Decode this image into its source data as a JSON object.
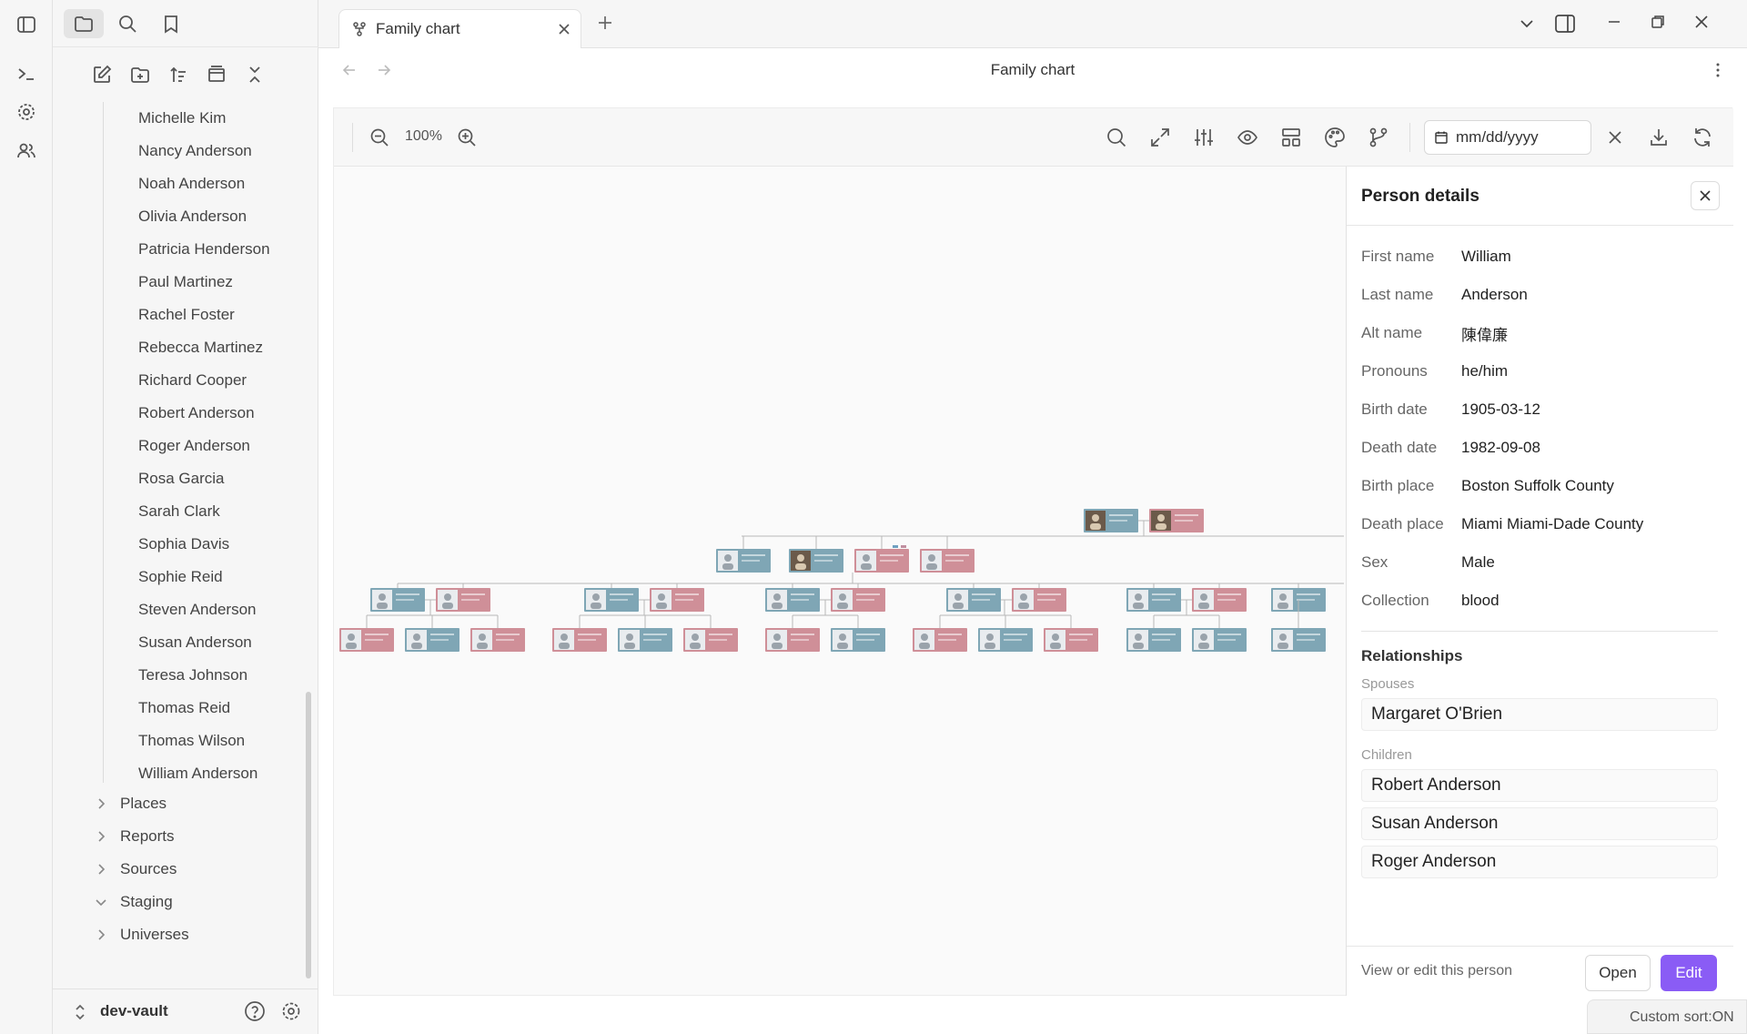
{
  "app": {
    "tab_title": "Family chart",
    "view_title": "Family chart",
    "vault_name": "dev-vault",
    "status": "Custom sort:ON"
  },
  "sidebar": {
    "people": [
      "Michelle Kim",
      "Nancy Anderson",
      "Noah Anderson",
      "Olivia Anderson",
      "Patricia Henderson",
      "Paul Martinez",
      "Rachel Foster",
      "Rebecca Martinez",
      "Richard Cooper",
      "Robert Anderson",
      "Roger Anderson",
      "Rosa Garcia",
      "Sarah Clark",
      "Sophia Davis",
      "Sophie Reid",
      "Steven Anderson",
      "Susan Anderson",
      "Teresa Johnson",
      "Thomas Reid",
      "Thomas Wilson",
      "William Anderson"
    ],
    "folders": [
      {
        "label": "Places",
        "expanded": false
      },
      {
        "label": "Reports",
        "expanded": false
      },
      {
        "label": "Sources",
        "expanded": false
      },
      {
        "label": "Staging",
        "expanded": true
      },
      {
        "label": "Universes",
        "expanded": false
      }
    ]
  },
  "toolbar": {
    "zoom": "100%",
    "date_placeholder": "mm/dd/yyyy"
  },
  "colors": {
    "male": "#7fa6b5",
    "female": "#cf8f98",
    "accent": "#8a5cf5"
  },
  "details": {
    "title": "Person details",
    "fields": [
      {
        "label": "First name",
        "value": "William"
      },
      {
        "label": "Last name",
        "value": "Anderson"
      },
      {
        "label": "Alt name",
        "value": "陳偉廉"
      },
      {
        "label": "Pronouns",
        "value": "he/him"
      },
      {
        "label": "Birth date",
        "value": "1905-03-12"
      },
      {
        "label": "Death date",
        "value": "1982-09-08"
      },
      {
        "label": "Birth place",
        "value": "Boston Suffolk County"
      },
      {
        "label": "Death place",
        "value": "Miami Miami-Dade County"
      },
      {
        "label": "Sex",
        "value": "Male"
      },
      {
        "label": "Collection",
        "value": "blood"
      }
    ],
    "relationships_title": "Relationships",
    "spouses_label": "Spouses",
    "spouses": [
      "Margaret O'Brien"
    ],
    "children_label": "Children",
    "children": [
      "Robert Anderson",
      "Susan Anderson",
      "Roger Anderson"
    ],
    "footer_text": "View or edit this person",
    "open_label": "Open",
    "edit_label": "Edit"
  }
}
